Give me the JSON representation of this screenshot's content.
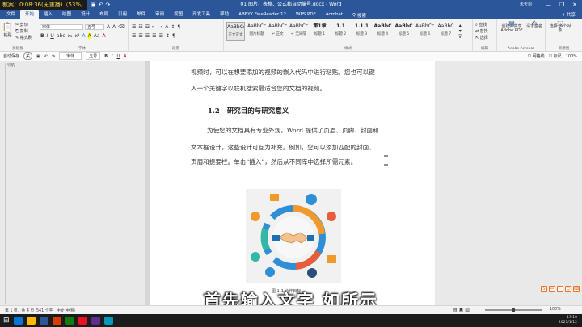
{
  "video_title": "教案：0:08:36(无重播)（53%）",
  "titlebar": {
    "doc_title": "01 图片、表格、公式都自动编号.docx - Word",
    "user": "朱天剑",
    "minimize": "—",
    "restore": "❐",
    "close": "✕"
  },
  "qat_icons": [
    "save-icon",
    "undo-icon",
    "redo-icon",
    "auto-icon"
  ],
  "tabs": [
    "文件",
    "开始",
    "插入",
    "绘图",
    "设计",
    "布局",
    "引用",
    "邮件",
    "审阅",
    "视图",
    "开发工具",
    "帮助",
    "ABBYY FineReader 12",
    "WPS PDF",
    "Acrobat"
  ],
  "active_tab": "开始",
  "tell_me": "搜索",
  "share": "共享",
  "ribbon": {
    "clipboard": {
      "paste": "粘贴",
      "cut": "剪切",
      "copy": "复制",
      "format_painter": "格式刷",
      "label": "剪贴板"
    },
    "font": {
      "name": "宋体",
      "size": "五号",
      "label": "字体",
      "tools": [
        "B",
        "I",
        "U",
        "abc",
        "x₂",
        "x²",
        "A",
        "A",
        "Aa",
        "A"
      ]
    },
    "paragraph": {
      "label": "段落",
      "tools": [
        "☰",
        "☰",
        "☰",
        "☰",
        "☰",
        "↕",
        "¶"
      ]
    },
    "styles": {
      "label": "样式",
      "items": [
        {
          "preview": "AaBbCcDd",
          "name": "正文正文",
          "selected": true
        },
        {
          "preview": "AaBbCcDd",
          "name": "图片标题"
        },
        {
          "preview": "AaBbCcDd",
          "name": "↵ 正文"
        },
        {
          "preview": "AaBbCcDd",
          "name": "↵ 无间隔"
        },
        {
          "preview": "第1章",
          "name": "标题 1"
        },
        {
          "preview": "1.1",
          "name": "标题 2"
        },
        {
          "preview": "1.1.1",
          "name": "标题 3"
        },
        {
          "preview": "AaBbC",
          "name": "标题 4"
        },
        {
          "preview": "AaBbC",
          "name": "标题 5"
        },
        {
          "preview": "AaBbCc",
          "name": "标题 6"
        },
        {
          "preview": "AaBbC",
          "name": "标题 7"
        }
      ]
    },
    "editing": {
      "find": "查找",
      "replace": "替换",
      "select": "选择",
      "label": "编辑"
    },
    "acrobat": {
      "create_pdf": "创建并共享 Adobe PDF",
      "request_sig": "请求签名",
      "label": "Adobe Acrobat"
    },
    "new_group": {
      "label": "新建组",
      "select_multi": "选择 多个对象"
    }
  },
  "qatbar": {
    "auto_save": "自动保存",
    "off": "关",
    "items": [
      "宋体",
      "五号"
    ],
    "grid": "网格线",
    "ruler_cb": "标尺",
    "zoom_label": "100%"
  },
  "nav": {
    "label": "导航"
  },
  "document": {
    "para1_line1": "视频时，可以在想要添加的视频的嵌入代码中进行粘贴。您也可以键",
    "para1_line2": "入一个关键字以联机搜索最适合您的文档的视频。",
    "heading_num": "1.2",
    "heading_text": "研究目的与研究意义",
    "para2_line1": "为使您的文档具有专业外观，Word 提供了页眉、页脚、封面和",
    "para2_line2": "文本框设计，这些设计可互为补充。例如，您可以添加匹配的封面、",
    "para2_line3": "页眉和提要栏。单击“插入”，然后从不同库中选择所需元素。",
    "caption": "图 1-1 合作目标"
  },
  "subtitle": "首先输入文字  如所示",
  "statusbar": {
    "page": "第 1 页，共 4 页",
    "words": "541 个字",
    "lang": "中文(中国)",
    "zoom": "100%"
  },
  "tray": {
    "time": "17:10",
    "date": "2021/1/12"
  },
  "sogou": [
    "S",
    "中",
    "·",
    "☺",
    "⌨"
  ],
  "taskbar_icons": [
    "#0078d7",
    "#ffb900",
    "#2b579a",
    "#d83b01",
    "#107c10",
    "#e81123",
    "#5c2d91",
    "#0099bc"
  ],
  "colors": {
    "word_blue": "#2b579a",
    "ribbon_bg": "#f3f3f3",
    "subtitle": "#ffffff"
  }
}
